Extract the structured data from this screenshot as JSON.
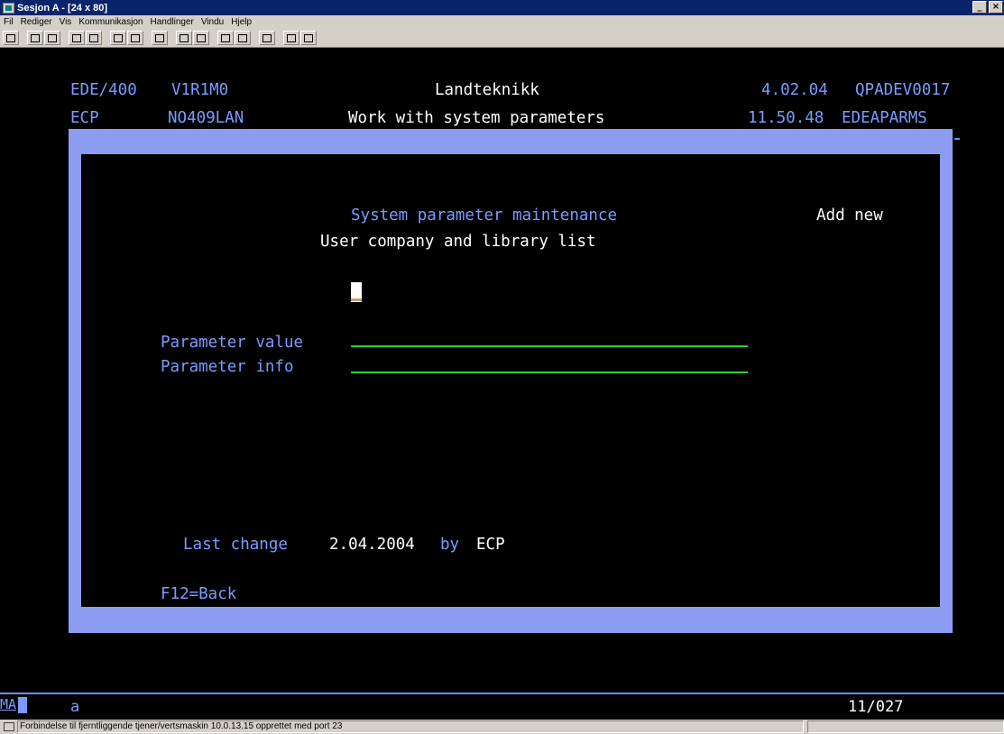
{
  "window": {
    "title": "Sesjon A - [24 x 80]",
    "buttons": [
      "_",
      "×"
    ]
  },
  "menu": [
    "Fil",
    "Rediger",
    "Vis",
    "Kommunikasjon",
    "Handlinger",
    "Vindu",
    "Hjelp"
  ],
  "header": {
    "sys": "EDE/400",
    "version": "V1R1M0",
    "company": "Landteknikk",
    "date": "4.02.04",
    "device": "QPADEV0017",
    "user": "ECP",
    "lan": "NO409LAN",
    "screen_title": "Work with system parameters",
    "time": "11.50.48",
    "program": "EDEAPARMS"
  },
  "popup": {
    "title": "System parameter maintenance",
    "mode": "Add new",
    "subtitle": "User company and library list",
    "fields": [
      {
        "label": "Parameter value",
        "value": ""
      },
      {
        "label": "Parameter info",
        "value": ""
      }
    ],
    "last_change_label": "Last change",
    "last_change_date": "2.04.2004",
    "by_label": "by",
    "by_user": "ECP",
    "fkey": "F12=Back"
  },
  "oia": {
    "indicator": "MA",
    "input_mode": "a",
    "cursor_pos": "11/027"
  },
  "statusbar": {
    "message": "Forbindelse til fjerntliggende tjener/vertsmaskin 10.0.13.15 opprettet med port 23"
  }
}
